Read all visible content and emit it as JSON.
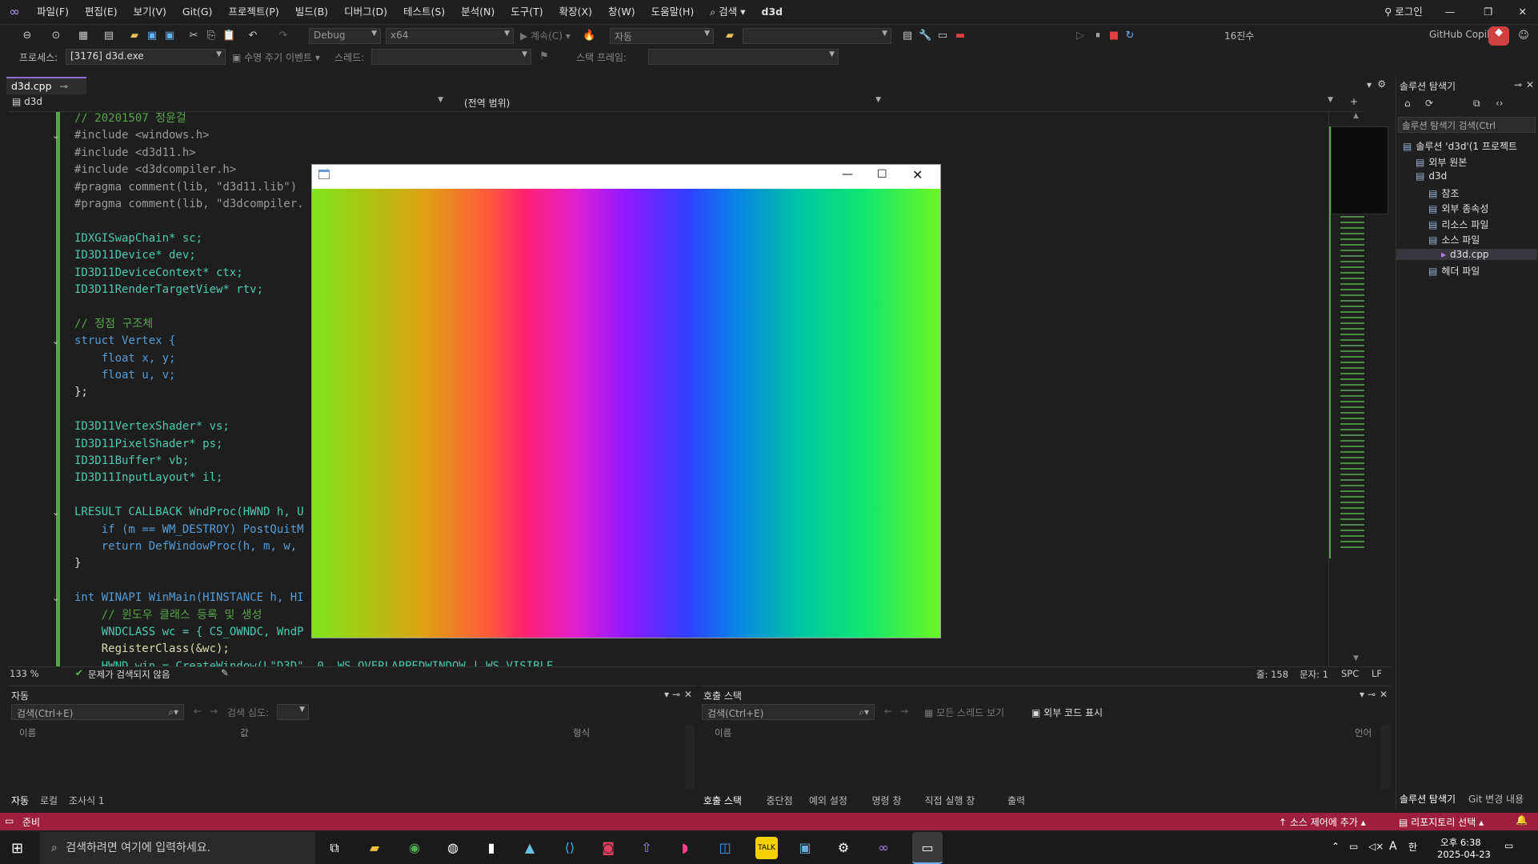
{
  "menubar": {
    "logo": "vs-logo-icon",
    "items": [
      "파일(F)",
      "편집(E)",
      "보기(V)",
      "Git(G)",
      "프로젝트(P)",
      "빌드(B)",
      "디버그(D)",
      "테스트(S)",
      "분석(N)",
      "도구(T)",
      "확장(X)",
      "창(W)",
      "도움말(H)"
    ],
    "search_label": "검색",
    "solution_name": "d3d",
    "login_label": "로그인"
  },
  "toolbar": {
    "config": "Debug",
    "platform": "x64",
    "continue_label": "계속(C)",
    "auto_label": "자동",
    "hex_label": "16진수",
    "github_label": "GitHub Copilot",
    "process_label": "프로세스:",
    "process_value": "[3176] d3d.exe",
    "lifecycle_label": "수명 주기 이벤트",
    "thread_label": "스레드:",
    "stackframe_label": "스택 프레임:"
  },
  "editor": {
    "tab_label": "d3d.cpp",
    "nav_project": "d3d",
    "nav_scope": "(전역 범위)",
    "zoom": "133 %",
    "issues": "문제가 검색되지 않음",
    "line_label": "줄: 158",
    "col_label": "문자: 1",
    "spc": "SPC",
    "lf": "LF",
    "lines": [
      {
        "cls": "cm",
        "text": "// 20201507 정윤걸"
      },
      {
        "cls": "pp",
        "text": "#include <windows.h>"
      },
      {
        "cls": "pp",
        "text": "#include <d3d11.h>"
      },
      {
        "cls": "pp",
        "text": "#include <d3dcompiler.h>"
      },
      {
        "cls": "pp",
        "text": "#pragma comment(lib, \"d3d11.lib\")"
      },
      {
        "cls": "pp",
        "text": "#pragma comment(lib, \"d3dcompiler."
      },
      {
        "cls": "pl",
        "text": ""
      },
      {
        "cls": "ty",
        "text": "IDXGISwapChain* sc;"
      },
      {
        "cls": "ty",
        "text": "ID3D11Device* dev;"
      },
      {
        "cls": "ty",
        "text": "ID3D11DeviceContext* ctx;"
      },
      {
        "cls": "ty",
        "text": "ID3D11RenderTargetView* rtv;"
      },
      {
        "cls": "pl",
        "text": ""
      },
      {
        "cls": "cm",
        "text": "// 정점 구조체"
      },
      {
        "cls": "kw",
        "text": "struct Vertex {"
      },
      {
        "cls": "kw",
        "text": "    float x, y;"
      },
      {
        "cls": "kw",
        "text": "    float u, v;"
      },
      {
        "cls": "pl",
        "text": "};"
      },
      {
        "cls": "pl",
        "text": ""
      },
      {
        "cls": "ty",
        "text": "ID3D11VertexShader* vs;"
      },
      {
        "cls": "ty",
        "text": "ID3D11PixelShader* ps;"
      },
      {
        "cls": "ty",
        "text": "ID3D11Buffer* vb;"
      },
      {
        "cls": "ty",
        "text": "ID3D11InputLayout* il;"
      },
      {
        "cls": "pl",
        "text": ""
      },
      {
        "cls": "ty",
        "text": "LRESULT CALLBACK WndProc(HWND h, U"
      },
      {
        "cls": "kw",
        "text": "    if (m == WM_DESTROY) PostQuitM"
      },
      {
        "cls": "kw",
        "text": "    return DefWindowProc(h, m, w,"
      },
      {
        "cls": "pl",
        "text": "}"
      },
      {
        "cls": "pl",
        "text": ""
      },
      {
        "cls": "kw",
        "text": "int WINAPI WinMain(HINSTANCE h, HI"
      },
      {
        "cls": "cm",
        "text": "    // 윈도우 클래스 등록 및 생성"
      },
      {
        "cls": "ty",
        "text": "    WNDCLASS wc = { CS_OWNDC, WndP"
      },
      {
        "cls": "fn",
        "text": "    RegisterClass(&wc);"
      },
      {
        "cls": "ty",
        "text": "    HWND win = CreateWindow(L\"D3D\", 0, WS_OVERLAPPEDWINDOW | WS_VISIBLE"
      }
    ]
  },
  "solution_explorer": {
    "title": "솔루션 탐색기",
    "search_placeholder": "솔루션 탐색기 검색(Ctrl",
    "items": [
      {
        "label": "솔루션 'd3d'(1 프로젝트",
        "indent": 0
      },
      {
        "label": "외부 원본",
        "indent": 1
      },
      {
        "label": "d3d",
        "indent": 1
      },
      {
        "label": "참조",
        "indent": 2
      },
      {
        "label": "외부 종속성",
        "indent": 2
      },
      {
        "label": "리소스 파일",
        "indent": 2
      },
      {
        "label": "소스 파일",
        "indent": 2
      },
      {
        "label": "d3d.cpp",
        "indent": 3
      },
      {
        "label": "헤더 파일",
        "indent": 2
      }
    ],
    "bottom_tabs": [
      "솔루션 탐색기",
      "Git 변경 내용"
    ]
  },
  "autos": {
    "title": "자동",
    "search_placeholder": "검색(Ctrl+E)",
    "depth_label": "검색 심도:",
    "columns": [
      "이름",
      "값",
      "형식"
    ],
    "tabs": [
      "자동",
      "로컬",
      "조사식 1"
    ]
  },
  "callstack": {
    "title": "호출 스택",
    "search_placeholder": "검색(Ctrl+E)",
    "all_threads": "모든 스레드 보기",
    "external_code": "외부 코드 표시",
    "columns": [
      "이름",
      "언어"
    ],
    "tabs": [
      "호출 스택",
      "중단점",
      "예외 설정",
      "명령 창",
      "직접 실행 창",
      "출력"
    ]
  },
  "statusbar": {
    "ready": "준비",
    "source_control": "소스 제어에 추가",
    "repo": "리포지토리 선택"
  },
  "taskbar": {
    "search_placeholder": "검색하려면 여기에 입력하세요.",
    "time": "오후 6:38",
    "date": "2025-04-23"
  },
  "app_window": {
    "title": ""
  },
  "colors": {
    "accent": "#8e6ad8",
    "statusbar": "#9e1e3f",
    "gutter": "#57a64a"
  }
}
